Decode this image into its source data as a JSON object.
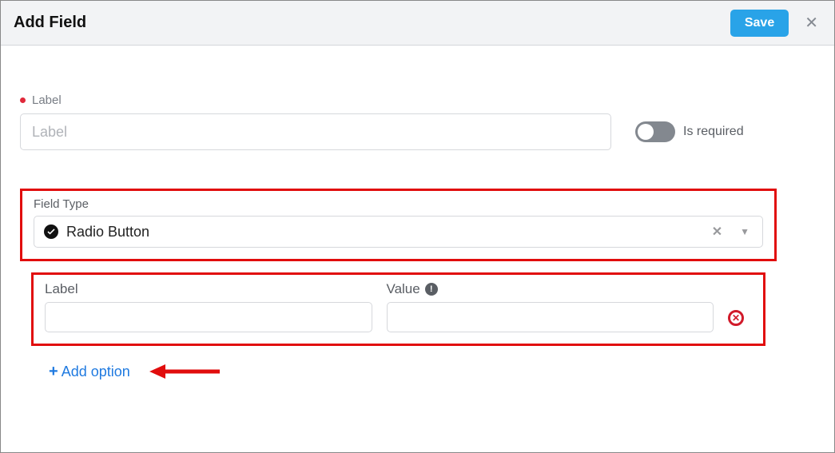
{
  "header": {
    "title": "Add Field",
    "save_label": "Save"
  },
  "label_section": {
    "label": "Label",
    "placeholder": "Label",
    "value": "",
    "required_toggle_label": "Is required"
  },
  "field_type": {
    "label": "Field Type",
    "selected": "Radio Button"
  },
  "option": {
    "label_header": "Label",
    "value_header": "Value",
    "label_value": "",
    "value_value": ""
  },
  "add_option_label": "Add option"
}
